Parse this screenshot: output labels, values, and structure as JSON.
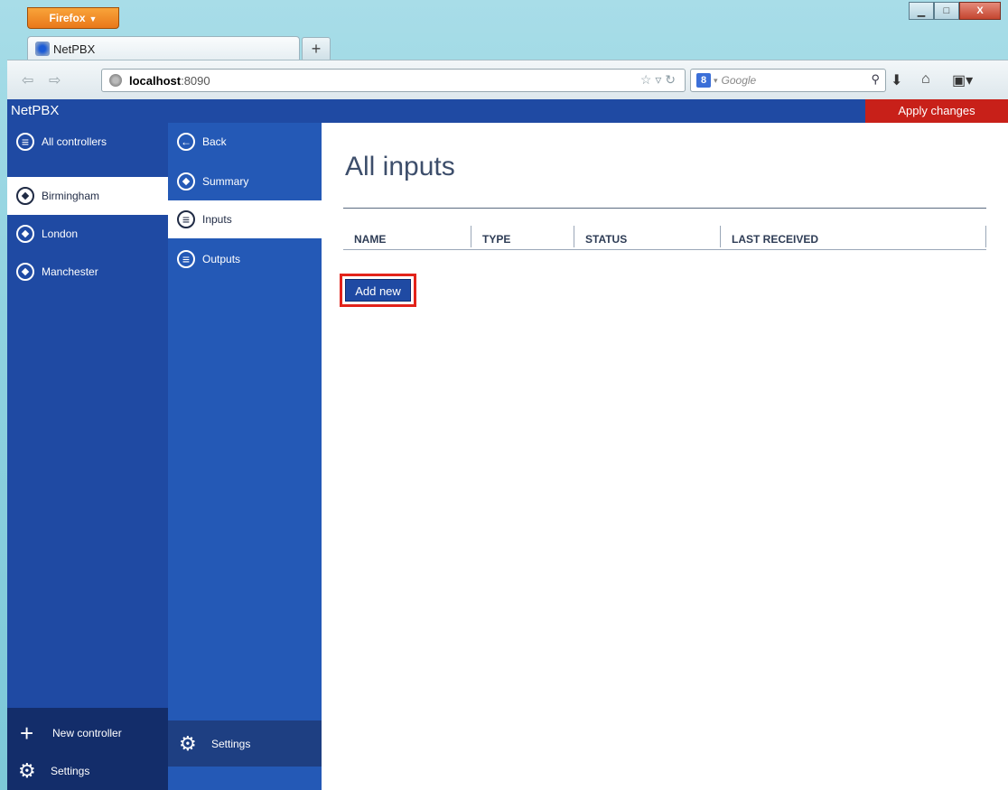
{
  "browser": {
    "menu_label": "Firefox",
    "tab_title": "NetPBX",
    "url_host": "localhost",
    "url_port": ":8090",
    "search_placeholder": "Google"
  },
  "app": {
    "title": "NetPBX",
    "apply_label": "Apply changes"
  },
  "controllers": {
    "all_label": "All controllers",
    "items": [
      {
        "label": "Birmingham",
        "active": true
      },
      {
        "label": "London",
        "active": false
      },
      {
        "label": "Manchester",
        "active": false
      }
    ],
    "new_label": "New controller",
    "settings_label": "Settings"
  },
  "submenu": {
    "items": [
      {
        "label": "Back",
        "icon": "back-arrow-icon"
      },
      {
        "label": "Summary",
        "icon": "diamond-icon"
      },
      {
        "label": "Inputs",
        "icon": "list-icon",
        "active": true
      },
      {
        "label": "Outputs",
        "icon": "list-icon"
      }
    ],
    "settings_label": "Settings"
  },
  "main": {
    "title": "All inputs",
    "columns": [
      "NAME",
      "TYPE",
      "STATUS",
      "LAST RECEIVED"
    ],
    "add_label": "Add new"
  },
  "colors": {
    "primary": "#1f4aa3",
    "apply": "#c82019",
    "highlight": "#e2231a"
  }
}
